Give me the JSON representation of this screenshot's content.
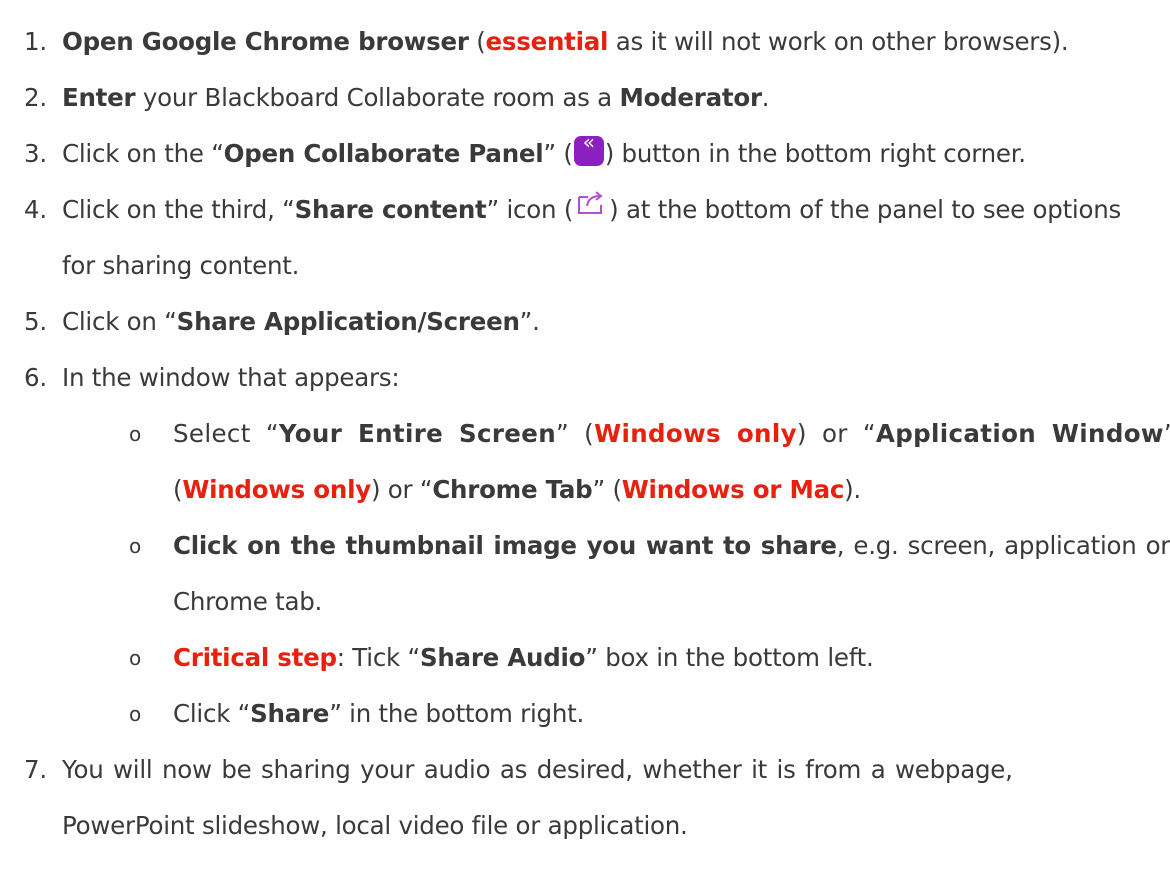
{
  "steps": [
    {
      "num": "1.",
      "parts": [
        {
          "t": "Open Google Chrome browser",
          "s": "b"
        },
        {
          "t": " (",
          "s": ""
        },
        {
          "t": "essential",
          "s": "red"
        },
        {
          "t": " as it will not work on other browsers).",
          "s": ""
        }
      ]
    },
    {
      "num": "2.",
      "parts": [
        {
          "t": "Enter",
          "s": "b"
        },
        {
          "t": " your Blackboard Collaborate room as a ",
          "s": ""
        },
        {
          "t": "Moderator",
          "s": "b"
        },
        {
          "t": ".",
          "s": ""
        }
      ]
    },
    {
      "num": "3.",
      "parts": [
        {
          "t": "Click on the “",
          "s": ""
        },
        {
          "t": "Open Collaborate Panel",
          "s": "b"
        },
        {
          "t": "” (",
          "s": ""
        },
        {
          "icon": "collaborate-panel-icon"
        },
        {
          "t": ") button in the bottom right corner.",
          "s": ""
        }
      ]
    },
    {
      "num": "4.",
      "parts": [
        {
          "t": "Click on the third, “",
          "s": ""
        },
        {
          "t": "Share content",
          "s": "b"
        },
        {
          "t": "” icon (",
          "s": ""
        },
        {
          "icon": "share-content-icon"
        },
        {
          "t": ") at the bottom of the panel to see options",
          "s": ""
        }
      ],
      "continuation": "for sharing content."
    },
    {
      "num": "5.",
      "parts": [
        {
          "t": "Click on “",
          "s": ""
        },
        {
          "t": "Share Application/Screen",
          "s": "b"
        },
        {
          "t": "”.",
          "s": ""
        }
      ]
    },
    {
      "num": "6.",
      "parts": [
        {
          "t": "In the window that appears:",
          "s": ""
        }
      ]
    },
    {
      "num": "7.",
      "parts": [
        {
          "t": "You will now be sharing your audio as desired, whether it is from a webpage,",
          "s": ""
        }
      ],
      "continuation": "PowerPoint slideshow, local video file or application."
    }
  ],
  "sub_steps": [
    {
      "bullet": "o",
      "line1": [
        {
          "t": "Select “",
          "s": ""
        },
        {
          "t": "Your Entire Screen",
          "s": "b"
        },
        {
          "t": "” (",
          "s": ""
        },
        {
          "t": "Windows only",
          "s": "red"
        },
        {
          "t": ") or “",
          "s": ""
        },
        {
          "t": "Application Window",
          "s": "b"
        },
        {
          "t": "”",
          "s": ""
        }
      ],
      "line2": [
        {
          "t": "(",
          "s": ""
        },
        {
          "t": "Windows only",
          "s": "red"
        },
        {
          "t": ") or “",
          "s": ""
        },
        {
          "t": "Chrome Tab",
          "s": "b"
        },
        {
          "t": "” (",
          "s": ""
        },
        {
          "t": "Windows or Mac",
          "s": "red"
        },
        {
          "t": ").",
          "s": ""
        }
      ]
    },
    {
      "bullet": "o",
      "line1": [
        {
          "t": "Click on the thumbnail image you want to share",
          "s": "b"
        },
        {
          "t": ", e.g. screen, application or",
          "s": ""
        }
      ],
      "line2": [
        {
          "t": "Chrome tab.",
          "s": ""
        }
      ]
    },
    {
      "bullet": "o",
      "line1": [
        {
          "t": "Critical step",
          "s": "red"
        },
        {
          "t": ": Tick “",
          "s": ""
        },
        {
          "t": "Share Audio",
          "s": "b"
        },
        {
          "t": "” box in the bottom left.",
          "s": ""
        }
      ]
    },
    {
      "bullet": "o",
      "line1": [
        {
          "t": "Click “",
          "s": ""
        },
        {
          "t": "Share",
          "s": "b"
        },
        {
          "t": "” in the bottom right.",
          "s": ""
        }
      ]
    }
  ],
  "colors": {
    "text": "#3a3a3a",
    "emphasis_red": "#e8200f",
    "collaborate_purple": "#8b1fbf",
    "share_icon_purple": "#b34fd6"
  }
}
